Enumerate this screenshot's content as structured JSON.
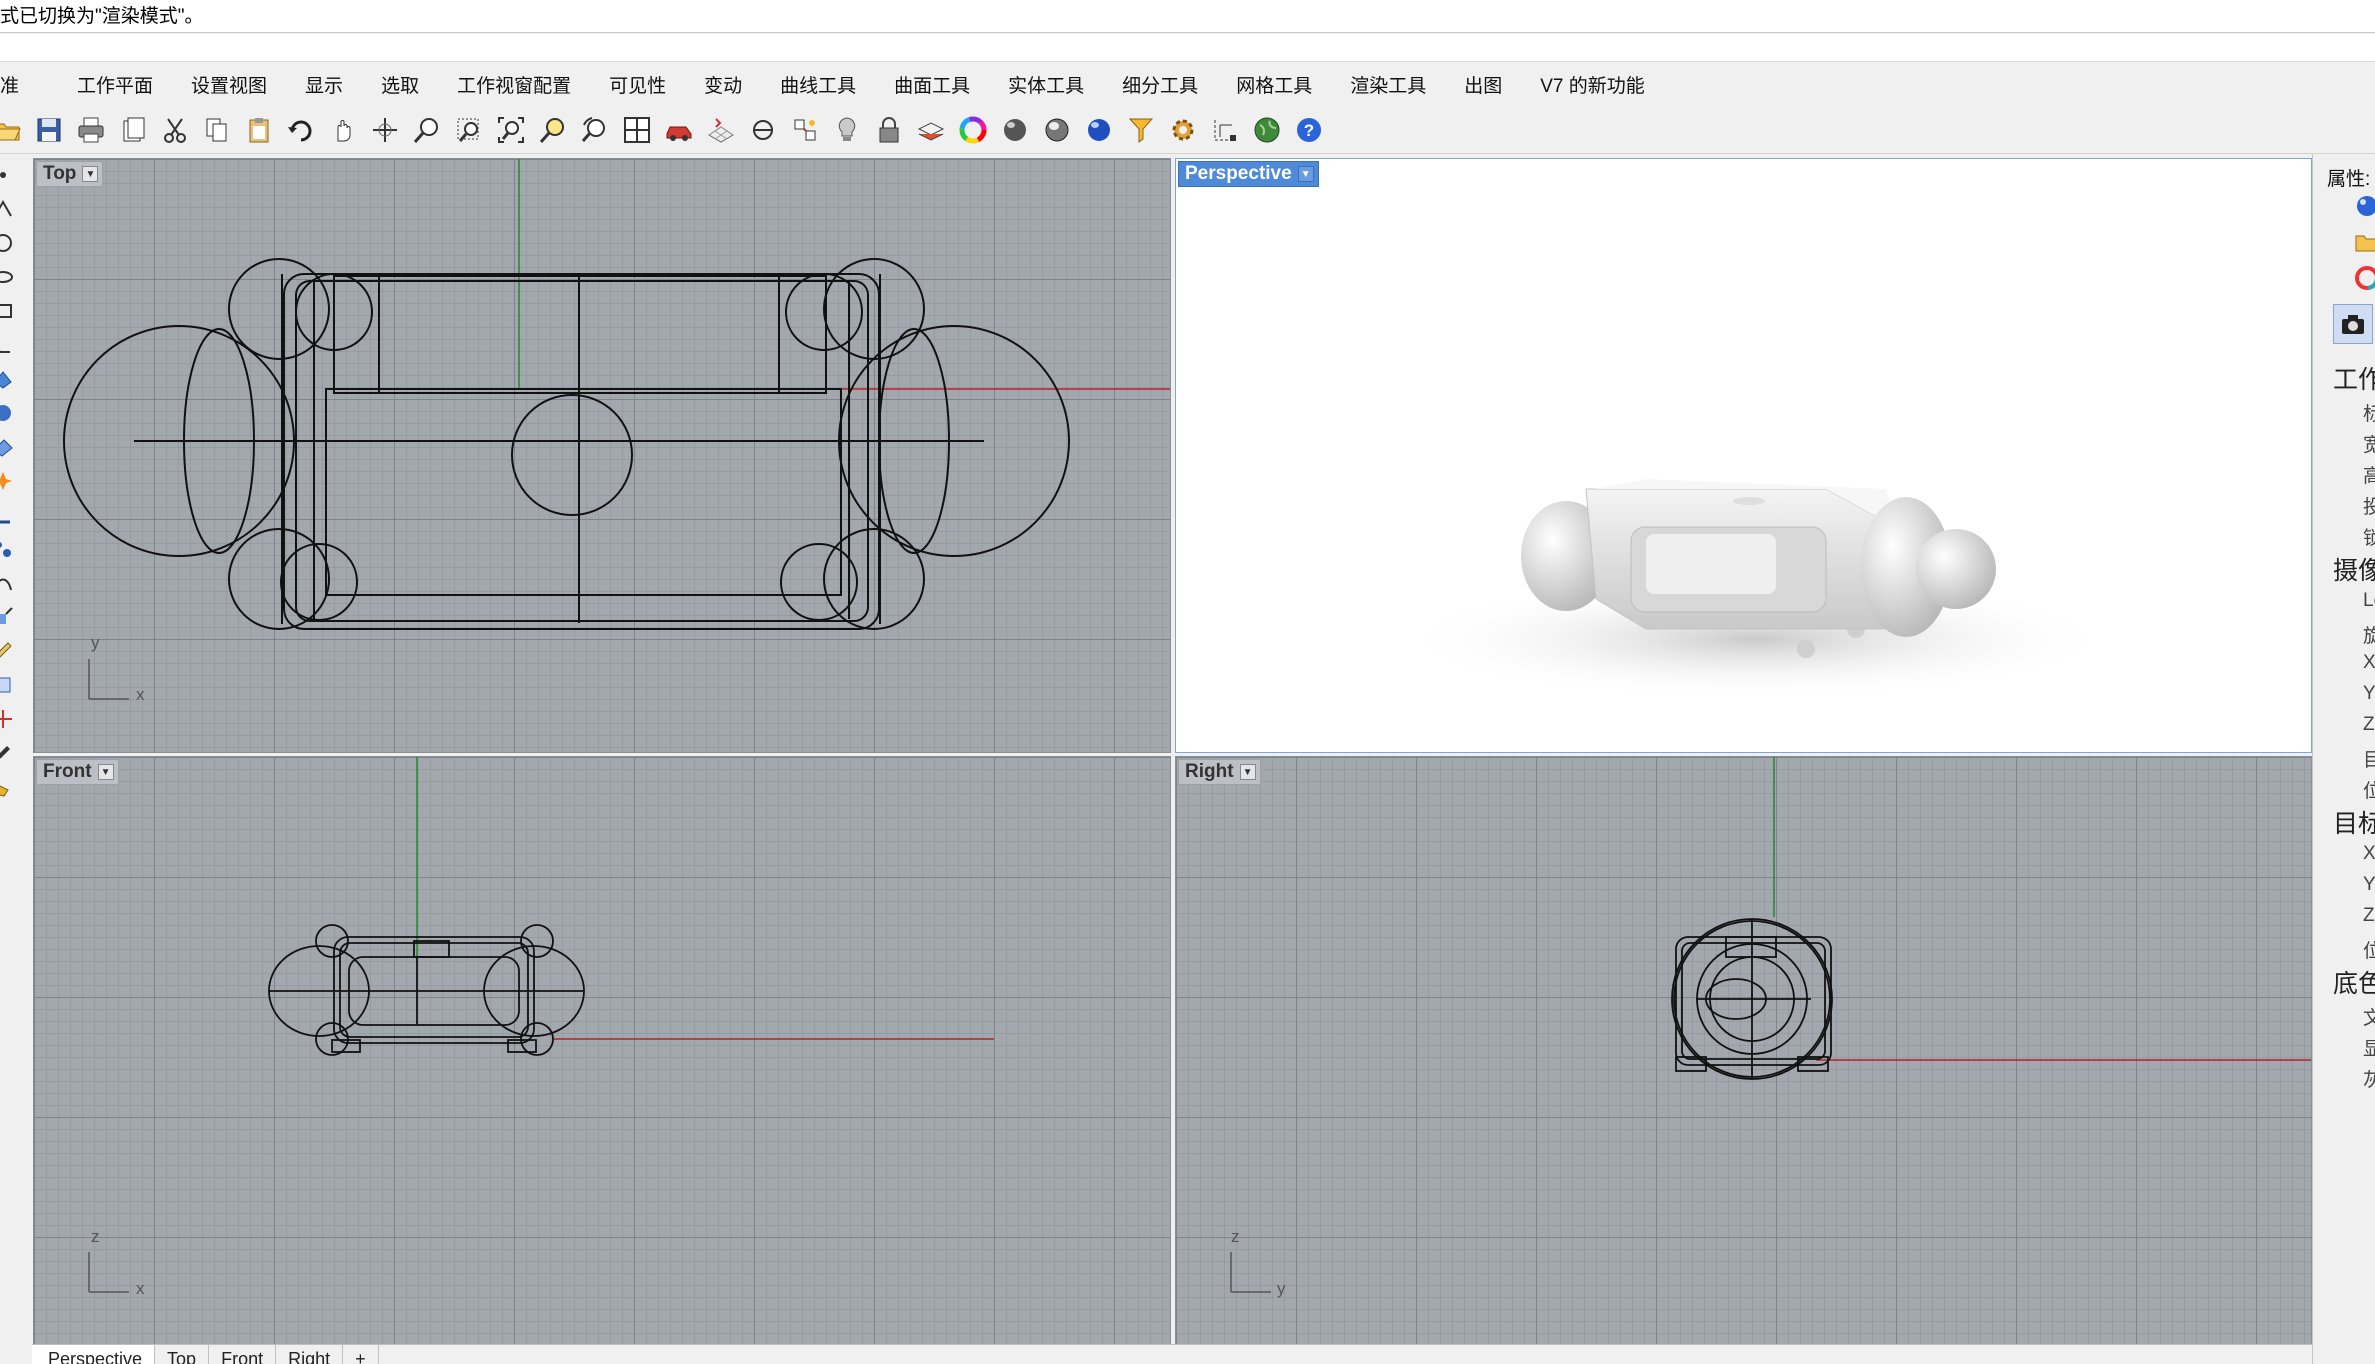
{
  "command_line": {
    "message": "式已切换为\"渲染模式\"。"
  },
  "menu": {
    "tabs": [
      "准",
      "工作平面",
      "设置视图",
      "显示",
      "选取",
      "工作视窗配置",
      "可见性",
      "变动",
      "曲线工具",
      "曲面工具",
      "实体工具",
      "细分工具",
      "网格工具",
      "渲染工具",
      "出图",
      "V7 的新功能"
    ]
  },
  "viewports": {
    "top": {
      "label": "Top",
      "axis_v": "y",
      "axis_h": "x"
    },
    "perspective": {
      "label": "Perspective"
    },
    "front": {
      "label": "Front",
      "axis_v": "z",
      "axis_h": "x"
    },
    "right": {
      "label": "Right",
      "axis_v": "z",
      "axis_h": "y"
    }
  },
  "right_panel": {
    "title": "属性:",
    "sections": [
      {
        "label": "工作",
        "items": [
          "标",
          "宽",
          "高",
          "投",
          "锁"
        ]
      },
      {
        "label": "摄像",
        "items": [
          "Le",
          "旋",
          "X",
          "Y",
          "Z",
          "目",
          "位"
        ]
      },
      {
        "label": "目标",
        "items": [
          "X",
          "Y",
          "Z",
          "位"
        ]
      },
      {
        "label": "底色",
        "items": [
          "文",
          "显",
          "灰"
        ]
      }
    ]
  },
  "bottom_tabs": [
    "Perspective",
    "Top",
    "Front",
    "Right",
    "+"
  ],
  "colors": {
    "viewport_bg": "#a3a8af",
    "active_viewport_label": "#4f8ad8",
    "x_axis": "#b4232a",
    "y_axis": "#1f8b2a"
  },
  "icons": {
    "toolbar": [
      "open-icon",
      "save-icon",
      "print-icon",
      "copy-to-clipboard-icon",
      "cut-icon",
      "copy-icon",
      "paste-icon",
      "undo-icon",
      "pan-icon",
      "rotate-view-icon",
      "zoom-icon",
      "zoom-window-icon",
      "zoom-extents-icon",
      "zoom-selected-icon",
      "undo-view-icon",
      "four-viewports-icon",
      "car-icon",
      "grid-options-icon",
      "snap-icon",
      "properties-icon",
      "light-icon",
      "lock-icon",
      "layer-icon",
      "color-wheel-icon",
      "shaded-sphere-icon",
      "rendered-sphere-icon",
      "render-icon",
      "select-filter-icon",
      "options-gear-icon",
      "dimension-icon",
      "globe-icon",
      "help-icon"
    ]
  }
}
